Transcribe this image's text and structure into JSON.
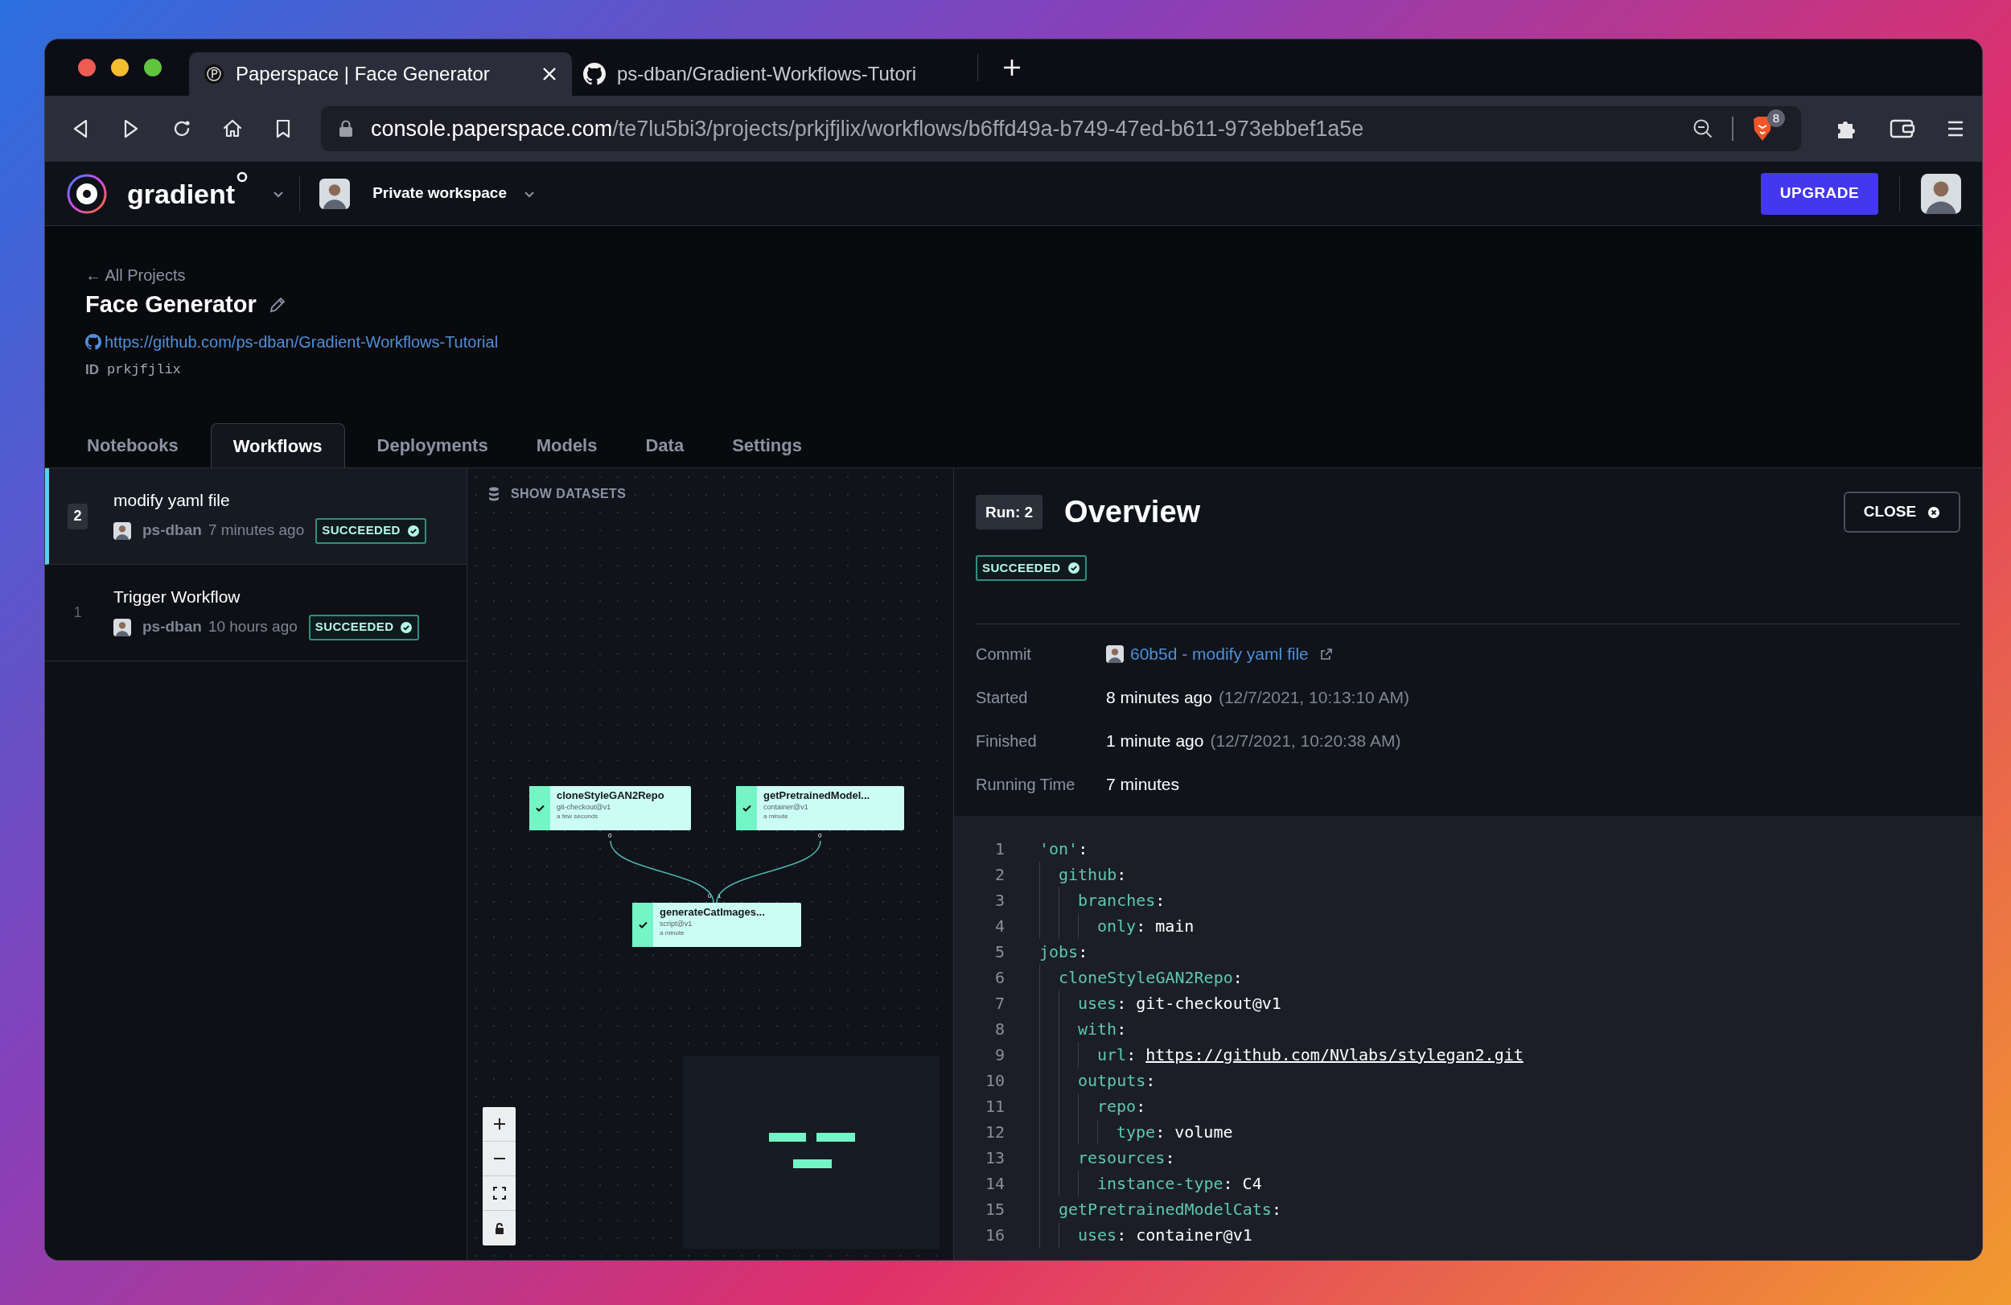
{
  "browser": {
    "tabs": [
      {
        "title": "Paperspace | Face Generator",
        "selected": true
      },
      {
        "title": "ps-dban/Gradient-Workflows-Tutori",
        "selected": false
      }
    ],
    "address": {
      "host": "console.paperspace.com",
      "path": "/te7lu5bi3/projects/prkjfjlix/workflows/b6ffd49a-b749-47ed-b611-973ebbef1a5e"
    },
    "shield_count": "8"
  },
  "app_header": {
    "logo": "gradient",
    "workspace": "Private workspace",
    "upgrade": "UPGRADE"
  },
  "project": {
    "back": "← All Projects",
    "title": "Face Generator",
    "repo": "https://github.com/ps-dban/Gradient-Workflows-Tutorial",
    "id_label": "ID",
    "id": "prkjfjlix"
  },
  "tabs": [
    {
      "label": "Notebooks",
      "selected": false
    },
    {
      "label": "Workflows",
      "selected": true
    },
    {
      "label": "Deployments",
      "selected": false
    },
    {
      "label": "Models",
      "selected": false
    },
    {
      "label": "Data",
      "selected": false
    },
    {
      "label": "Settings",
      "selected": false
    }
  ],
  "runs": [
    {
      "number": "2",
      "title": "modify yaml file",
      "user": "ps-dban",
      "when": "7 minutes ago",
      "status": "SUCCEEDED",
      "selected": true
    },
    {
      "number": "1",
      "title": "Trigger Workflow",
      "user": "ps-dban",
      "when": "10 hours ago",
      "status": "SUCCEEDED",
      "selected": false
    }
  ],
  "graph": {
    "show_datasets": "SHOW DATASETS",
    "nodes": [
      {
        "name": "cloneStyleGAN2Repo",
        "action": "git-checkout@v1",
        "time": "a few seconds",
        "done": true,
        "outputs": [
          "0"
        ]
      },
      {
        "name": "getPretrainedModel...",
        "action": "container@v1",
        "time": "a minute",
        "done": true,
        "outputs": [
          "0"
        ]
      },
      {
        "name": "generateCatImages...",
        "action": "script@v1",
        "time": "a minute",
        "done": true,
        "inputs": [
          "0",
          "1"
        ]
      }
    ]
  },
  "overview": {
    "run": "Run: 2",
    "title": "Overview",
    "close": "CLOSE",
    "status": "SUCCEEDED",
    "details": [
      {
        "kind": "commit",
        "label": "Commit",
        "value": "60b5d - modify yaml file"
      },
      {
        "kind": "time",
        "label": "Started",
        "value": "8 minutes ago",
        "note": "(12/7/2021, 10:13:10 AM)"
      },
      {
        "kind": "time",
        "label": "Finished",
        "value": "1 minute ago",
        "note": "(12/7/2021, 10:20:38 AM)"
      },
      {
        "kind": "time",
        "label": "Running Time",
        "value": "7 minutes"
      }
    ]
  },
  "code": [
    {
      "number": "1",
      "key": "'on'",
      "tail": ":",
      "children": [
        {
          "number": "2",
          "key": "github",
          "tail": ":",
          "children": [
            {
              "number": "3",
              "key": "branches",
              "tail": ":",
              "children": [
                {
                  "number": "4",
                  "key": "only",
                  "tail": ":",
                  "value": "main"
                }
              ]
            }
          ]
        }
      ]
    },
    {
      "number": "5",
      "key": "jobs",
      "tail": ":",
      "children": [
        {
          "number": "6",
          "key": "cloneStyleGAN2Repo",
          "tail": ":",
          "children": [
            {
              "number": "7",
              "key": "uses",
              "tail": ":",
              "value": "git-checkout@v1"
            },
            {
              "number": "8",
              "key": "with",
              "tail": ":",
              "children": [
                {
                  "number": "9",
                  "key": "url",
                  "tail": ":",
                  "link": "https://github.com/NVlabs/stylegan2.git"
                }
              ]
            },
            {
              "number": "10",
              "key": "outputs",
              "tail": ":",
              "children": [
                {
                  "number": "11",
                  "key": "repo",
                  "tail": ":",
                  "children": [
                    {
                      "number": "12",
                      "key": "type",
                      "tail": ":",
                      "value": "volume"
                    }
                  ]
                }
              ]
            },
            {
              "number": "13",
              "key": "resources",
              "tail": ":",
              "children": [
                {
                  "number": "14",
                  "key": "instance-type",
                  "tail": ":",
                  "value": "C4"
                }
              ]
            }
          ]
        },
        {
          "number": "15",
          "key": "getPretrainedModelCats",
          "tail": ":",
          "children": [
            {
              "number": "16",
              "key": "uses",
              "tail": ":",
              "value": "container@v1"
            }
          ]
        }
      ]
    }
  ]
}
